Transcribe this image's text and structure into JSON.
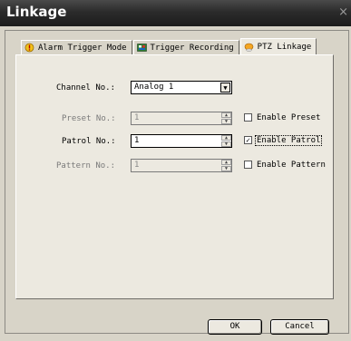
{
  "window": {
    "title": "Linkage",
    "close_glyph": "×"
  },
  "tabs": [
    {
      "label": "Alarm Trigger Mode",
      "icon": "alarm-bell-icon",
      "active": false
    },
    {
      "label": "Trigger Recording",
      "icon": "record-icon",
      "active": false
    },
    {
      "label": "PTZ Linkage",
      "icon": "ptz-camera-icon",
      "active": true
    }
  ],
  "form": {
    "channel": {
      "label": "Channel No.:",
      "value": "Analog 1"
    },
    "preset": {
      "label": "Preset No.:",
      "value": "1",
      "enabled": false,
      "checkbox_label": "Enable Preset",
      "checked": false
    },
    "patrol": {
      "label": "Patrol No.:",
      "value": "1",
      "enabled": true,
      "checkbox_label": "Enable Patrol",
      "checked": true
    },
    "pattern": {
      "label": "Pattern No.:",
      "value": "1",
      "enabled": false,
      "checkbox_label": "Enable Pattern",
      "checked": false
    }
  },
  "buttons": {
    "ok": "OK",
    "cancel": "Cancel"
  },
  "colors": {
    "titlebar": "#2b2b2b",
    "panel": "#ece9e0",
    "window": "#d8d4c8"
  }
}
